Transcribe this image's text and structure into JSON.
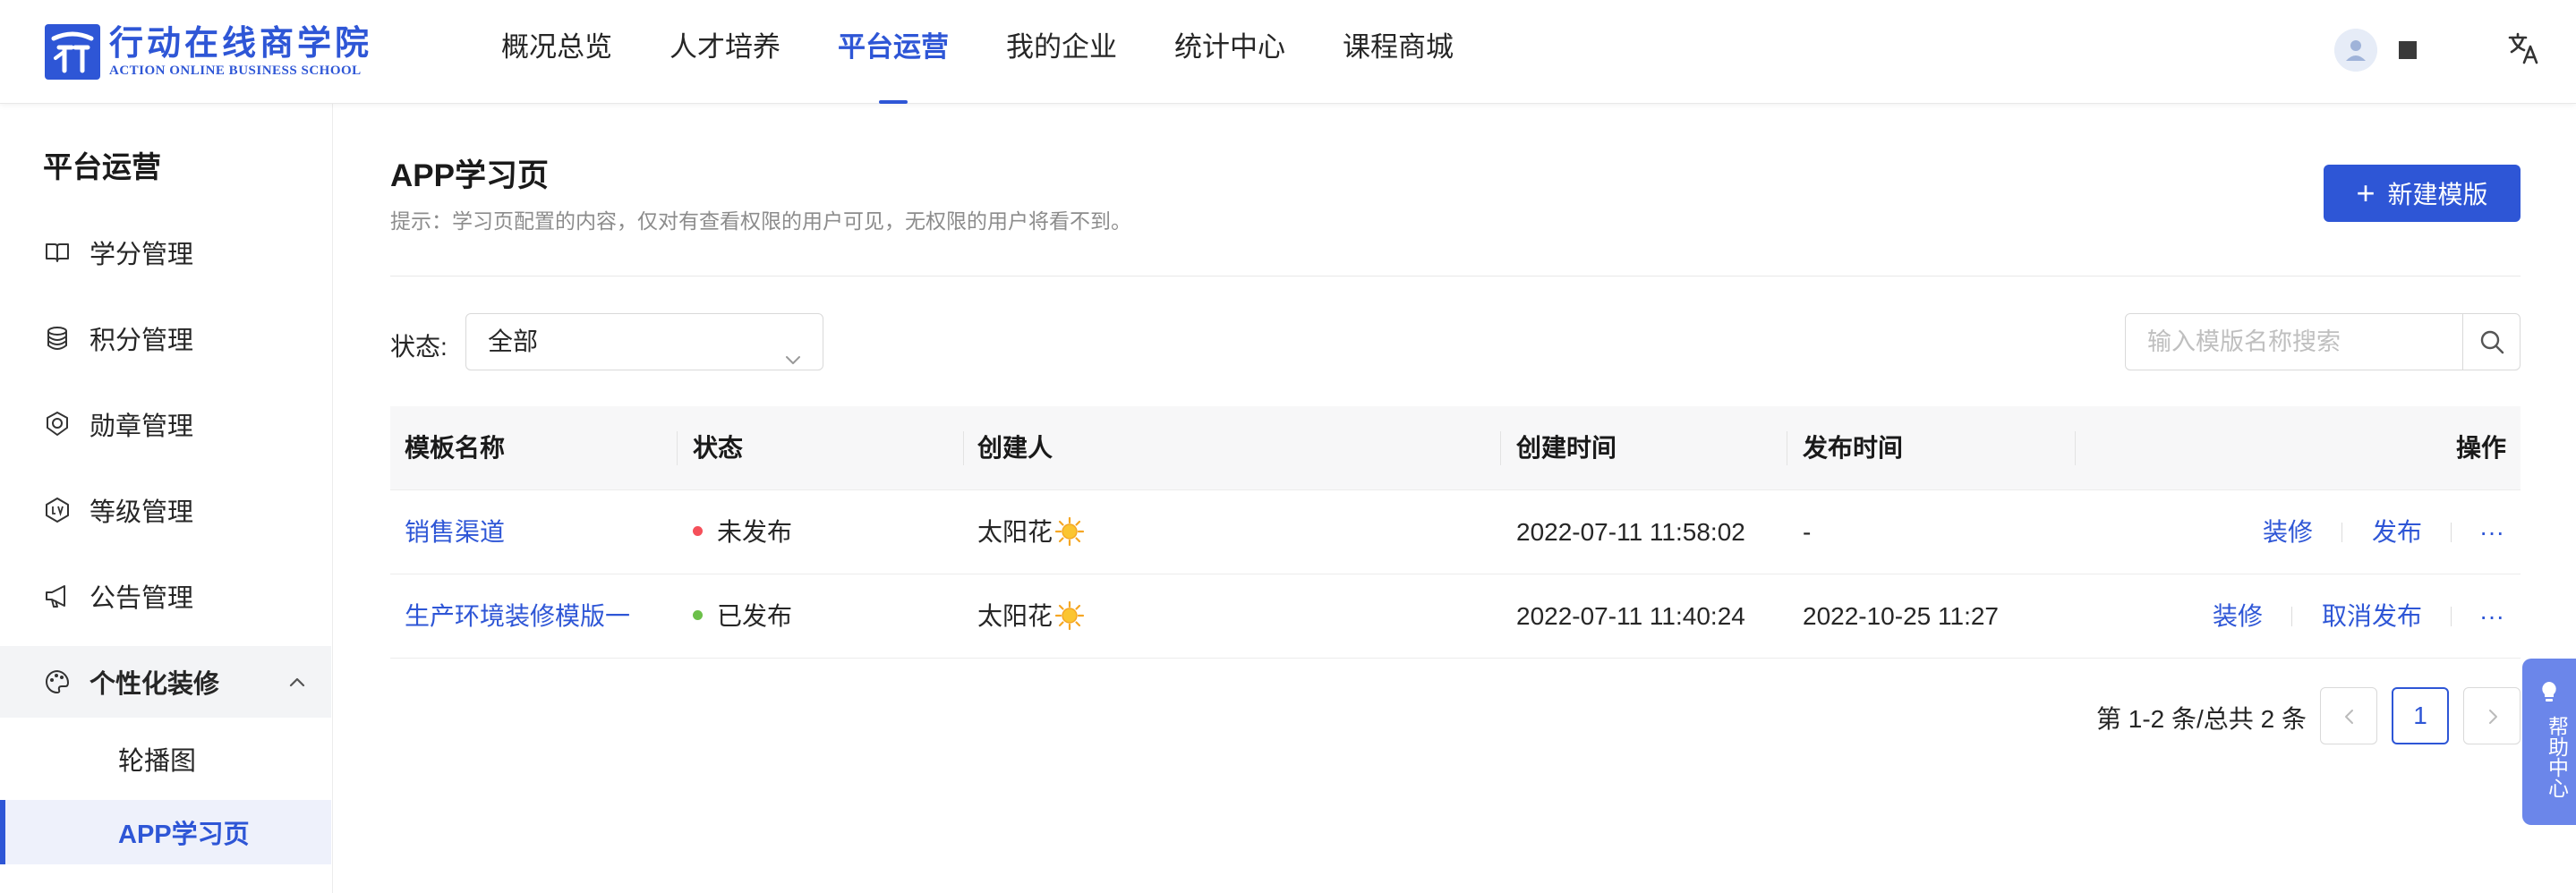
{
  "header": {
    "logo_cn": "行动在线商学院",
    "logo_en": "ACTION ONLINE BUSINESS SCHOOL",
    "nav": [
      {
        "label": "概况总览",
        "active": false
      },
      {
        "label": "人才培养",
        "active": false
      },
      {
        "label": "平台运营",
        "active": true
      },
      {
        "label": "我的企业",
        "active": false
      },
      {
        "label": "统计中心",
        "active": false
      },
      {
        "label": "课程商城",
        "active": false
      }
    ],
    "icons": {
      "avatar": "user-avatar-icon",
      "language": "translate-icon"
    }
  },
  "sidebar": {
    "title": "平台运营",
    "items": [
      {
        "label": "学分管理",
        "icon": "book-icon"
      },
      {
        "label": "积分管理",
        "icon": "coins-stack-icon"
      },
      {
        "label": "勋章管理",
        "icon": "medal-icon"
      },
      {
        "label": "等级管理",
        "icon": "level-badge-icon"
      },
      {
        "label": "公告管理",
        "icon": "megaphone-icon"
      }
    ],
    "group": {
      "label": "个性化装修",
      "icon": "palette-icon",
      "expanded": true
    },
    "sub_items": [
      {
        "label": "轮播图",
        "active": false
      },
      {
        "label": "APP学习页",
        "active": true
      }
    ]
  },
  "main": {
    "title": "APP学习页",
    "hint": "提示：学习页配置的内容，仅对有查看权限的用户可见，无权限的用户将看不到。",
    "new_button": "新建模版",
    "filter": {
      "label": "状态:",
      "value": "全部"
    },
    "search": {
      "placeholder": "输入模版名称搜索"
    },
    "table": {
      "headers": [
        "模板名称",
        "状态",
        "创建人",
        "创建时间",
        "发布时间",
        "操作"
      ],
      "rows": [
        {
          "name": "销售渠道",
          "status": "未发布",
          "status_color": "#f5505a",
          "creator": "太阳花",
          "created": "2022-07-11 11:58:02",
          "published": "-",
          "actions": [
            "装修",
            "发布",
            "···"
          ]
        },
        {
          "name": "生产环境装修模版一",
          "status": "已发布",
          "status_color": "#6cc04a",
          "creator": "太阳花",
          "created": "2022-07-11 11:40:24",
          "published": "2022-10-25 11:27",
          "actions": [
            "装修",
            "取消发布",
            "···"
          ]
        }
      ]
    },
    "pagination": {
      "summary": "第 1-2 条/总共 2 条",
      "current": "1"
    }
  },
  "help": {
    "label": "帮助中心"
  },
  "colors": {
    "primary": "#2e56d6",
    "help_bg": "#6b86ea"
  }
}
